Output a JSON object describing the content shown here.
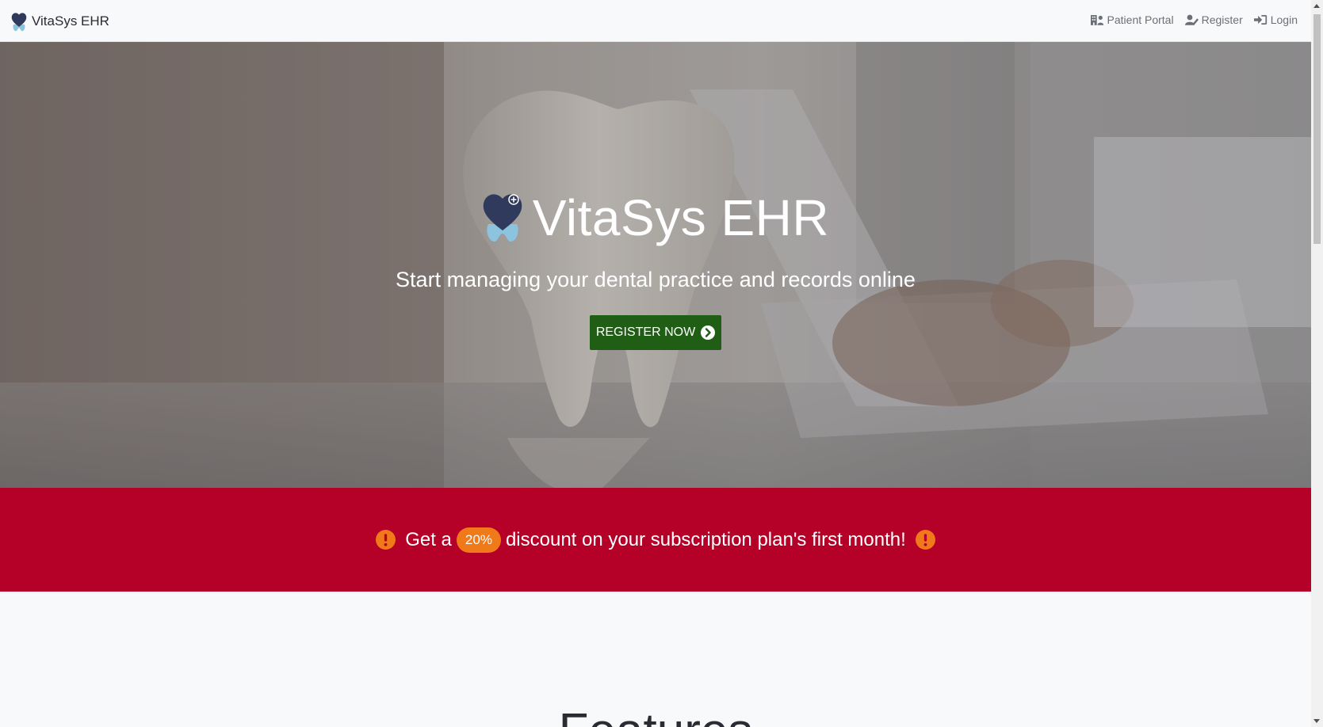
{
  "navbar": {
    "brand": "VitaSys EHR",
    "links": [
      {
        "label": "Patient Portal",
        "icon": "hospital-user-icon"
      },
      {
        "label": "Register",
        "icon": "user-pen-icon"
      },
      {
        "label": "Login",
        "icon": "sign-in-icon"
      }
    ]
  },
  "hero": {
    "title": "VitaSys EHR",
    "subtitle": "Start managing your dental practice and records online",
    "cta_label": "REGISTER NOW",
    "cta_icon": "circle-chevron-right-icon"
  },
  "promo": {
    "prefix": "Get a",
    "badge": "20%",
    "suffix": "discount on your subscription plan's first month!",
    "icon": "exclamation-circle-icon"
  },
  "features": {
    "heading": "Features"
  },
  "colors": {
    "brand_navy": "#2f3a5c",
    "brand_light_blue": "#8cc4e0",
    "cta_green": "#1f5e14",
    "promo_red": "#b50027",
    "badge_orange": "#f07a1a",
    "nav_text": "#6b6f75"
  }
}
